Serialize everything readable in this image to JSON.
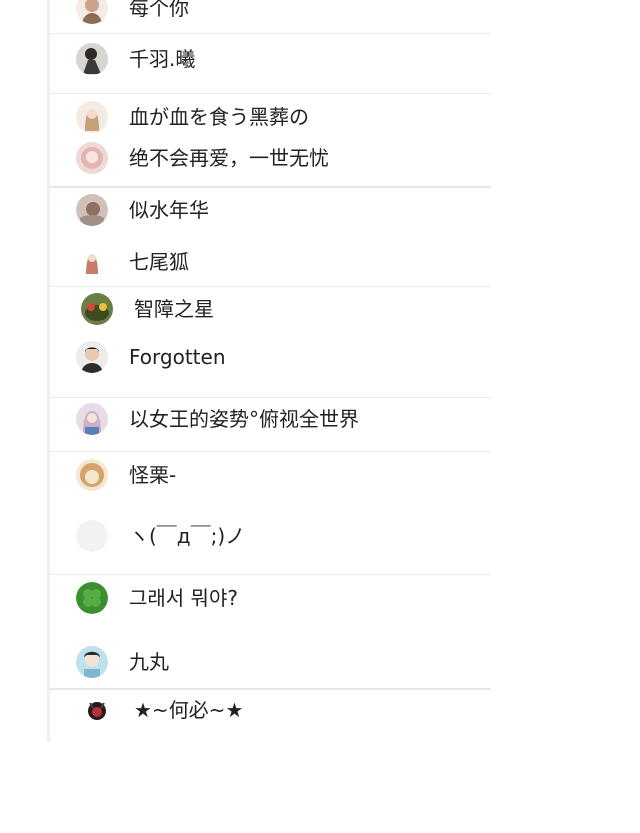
{
  "contacts": [
    {
      "name": "每个你",
      "avatar_color": "#c9a48a",
      "icon": "avatar-girl-icon"
    },
    {
      "name": "千羽.曦",
      "avatar_color": "#3a3a3a",
      "icon": "avatar-figure-icon"
    },
    {
      "name": "血が血を食う黑葬の",
      "avatar_color": "#d9c2a6",
      "icon": "avatar-girl-icon"
    },
    {
      "name": "绝不会再爱，一世无忧",
      "avatar_color": "#e2b4b4",
      "icon": "avatar-girl-icon"
    },
    {
      "name": "似水年华",
      "avatar_color": "#b79c8c",
      "icon": "avatar-scene-icon"
    },
    {
      "name": "七尾狐",
      "avatar_color": "#c77b6a",
      "icon": "avatar-fox-icon"
    },
    {
      "name": "智障之星",
      "avatar_color": "#6b7f45",
      "icon": "avatar-cartoon-icon"
    },
    {
      "name": "Forgotten",
      "avatar_color": "#2d2d2d",
      "icon": "avatar-boy-icon"
    },
    {
      "name": "以女王的姿势°俯视全世界",
      "avatar_color": "#c9b0c8",
      "icon": "avatar-girl-icon"
    },
    {
      "name": "怪栗-",
      "avatar_color": "#d4a46b",
      "icon": "avatar-anime-icon"
    },
    {
      "name": "ヽ(￣д￣;)ノ",
      "avatar_color": "#f1f3f1",
      "icon": "avatar-blank-icon"
    },
    {
      "name": "그래서 뭐야?",
      "avatar_color": "#3c8f2e",
      "icon": "avatar-clover-icon"
    },
    {
      "name": "九丸",
      "avatar_color": "#7fb6cf",
      "icon": "avatar-anime-icon"
    },
    {
      "name": "★~何必~★",
      "avatar_color": "#b8313a",
      "icon": "avatar-cartoon-icon"
    }
  ]
}
